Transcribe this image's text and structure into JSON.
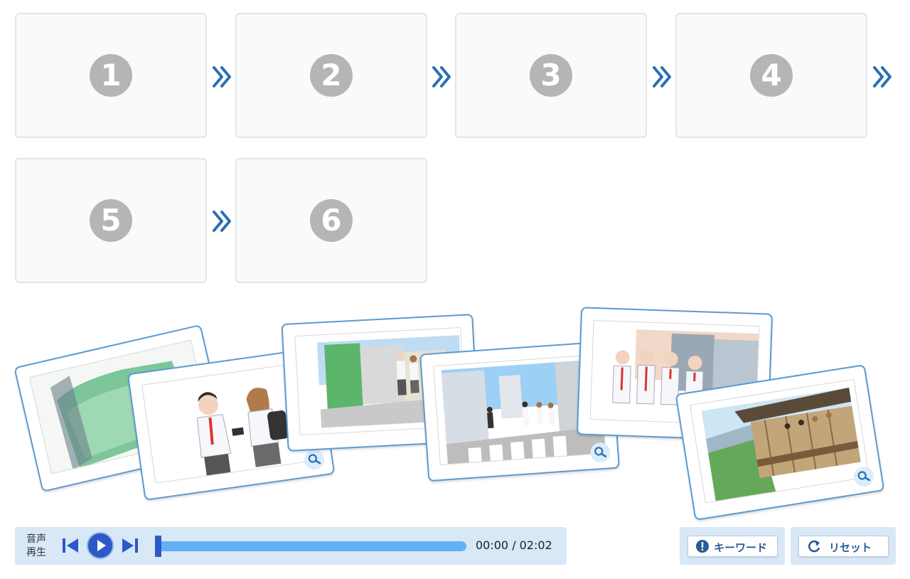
{
  "slots": [
    {
      "number": "1"
    },
    {
      "number": "2"
    },
    {
      "number": "3"
    },
    {
      "number": "4"
    },
    {
      "number": "5"
    },
    {
      "number": "6"
    }
  ],
  "icons": {
    "next_arrow": "double-chevron-right-icon",
    "zoom": "magnifier-icon",
    "skip_back": "skip-back-icon",
    "play": "play-icon",
    "skip_forward": "skip-forward-icon",
    "keyword": "exclamation-icon",
    "reset": "reset-arrow-icon"
  },
  "cards": [
    {
      "scene": "bus-seat"
    },
    {
      "scene": "two-students-exchange"
    },
    {
      "scene": "street-with-students"
    },
    {
      "scene": "crosswalk-city"
    },
    {
      "scene": "group-of-four-students"
    },
    {
      "scene": "temple-stage-view"
    }
  ],
  "player": {
    "label_line1": "音声",
    "label_line2": "再生",
    "time": "00:00 / 02:02",
    "progress": 0
  },
  "buttons": {
    "keyword": "キーワード",
    "reset": "リセット"
  },
  "colors": {
    "accent": "#2a6fb4",
    "card_border": "#5b9bd1",
    "panel_bg": "#d8e8f6",
    "progress": "#62b0f5",
    "slot_number": "#b5b5b5"
  }
}
